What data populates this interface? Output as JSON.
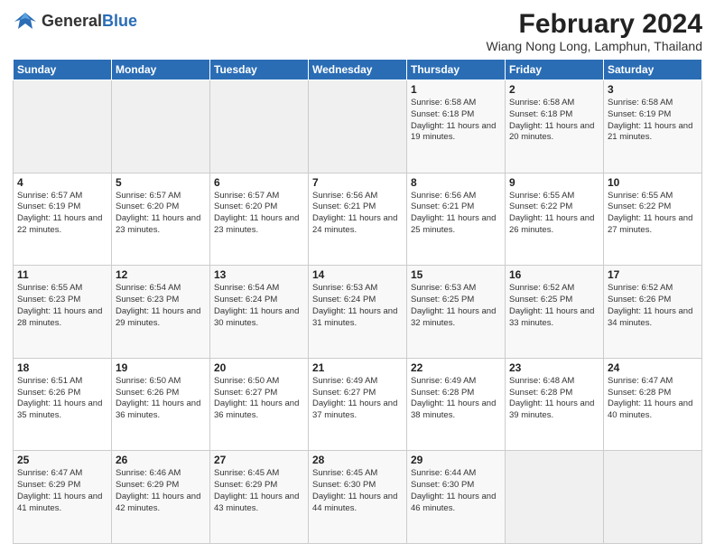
{
  "header": {
    "logo_general": "General",
    "logo_blue": "Blue",
    "title": "February 2024",
    "subtitle": "Wiang Nong Long, Lamphun, Thailand"
  },
  "weekdays": [
    "Sunday",
    "Monday",
    "Tuesday",
    "Wednesday",
    "Thursday",
    "Friday",
    "Saturday"
  ],
  "weeks": [
    [
      {
        "day": "",
        "sunrise": "",
        "sunset": "",
        "daylight": ""
      },
      {
        "day": "",
        "sunrise": "",
        "sunset": "",
        "daylight": ""
      },
      {
        "day": "",
        "sunrise": "",
        "sunset": "",
        "daylight": ""
      },
      {
        "day": "",
        "sunrise": "",
        "sunset": "",
        "daylight": ""
      },
      {
        "day": "1",
        "sunrise": "Sunrise: 6:58 AM",
        "sunset": "Sunset: 6:18 PM",
        "daylight": "Daylight: 11 hours and 19 minutes."
      },
      {
        "day": "2",
        "sunrise": "Sunrise: 6:58 AM",
        "sunset": "Sunset: 6:18 PM",
        "daylight": "Daylight: 11 hours and 20 minutes."
      },
      {
        "day": "3",
        "sunrise": "Sunrise: 6:58 AM",
        "sunset": "Sunset: 6:19 PM",
        "daylight": "Daylight: 11 hours and 21 minutes."
      }
    ],
    [
      {
        "day": "4",
        "sunrise": "Sunrise: 6:57 AM",
        "sunset": "Sunset: 6:19 PM",
        "daylight": "Daylight: 11 hours and 22 minutes."
      },
      {
        "day": "5",
        "sunrise": "Sunrise: 6:57 AM",
        "sunset": "Sunset: 6:20 PM",
        "daylight": "Daylight: 11 hours and 23 minutes."
      },
      {
        "day": "6",
        "sunrise": "Sunrise: 6:57 AM",
        "sunset": "Sunset: 6:20 PM",
        "daylight": "Daylight: 11 hours and 23 minutes."
      },
      {
        "day": "7",
        "sunrise": "Sunrise: 6:56 AM",
        "sunset": "Sunset: 6:21 PM",
        "daylight": "Daylight: 11 hours and 24 minutes."
      },
      {
        "day": "8",
        "sunrise": "Sunrise: 6:56 AM",
        "sunset": "Sunset: 6:21 PM",
        "daylight": "Daylight: 11 hours and 25 minutes."
      },
      {
        "day": "9",
        "sunrise": "Sunrise: 6:55 AM",
        "sunset": "Sunset: 6:22 PM",
        "daylight": "Daylight: 11 hours and 26 minutes."
      },
      {
        "day": "10",
        "sunrise": "Sunrise: 6:55 AM",
        "sunset": "Sunset: 6:22 PM",
        "daylight": "Daylight: 11 hours and 27 minutes."
      }
    ],
    [
      {
        "day": "11",
        "sunrise": "Sunrise: 6:55 AM",
        "sunset": "Sunset: 6:23 PM",
        "daylight": "Daylight: 11 hours and 28 minutes."
      },
      {
        "day": "12",
        "sunrise": "Sunrise: 6:54 AM",
        "sunset": "Sunset: 6:23 PM",
        "daylight": "Daylight: 11 hours and 29 minutes."
      },
      {
        "day": "13",
        "sunrise": "Sunrise: 6:54 AM",
        "sunset": "Sunset: 6:24 PM",
        "daylight": "Daylight: 11 hours and 30 minutes."
      },
      {
        "day": "14",
        "sunrise": "Sunrise: 6:53 AM",
        "sunset": "Sunset: 6:24 PM",
        "daylight": "Daylight: 11 hours and 31 minutes."
      },
      {
        "day": "15",
        "sunrise": "Sunrise: 6:53 AM",
        "sunset": "Sunset: 6:25 PM",
        "daylight": "Daylight: 11 hours and 32 minutes."
      },
      {
        "day": "16",
        "sunrise": "Sunrise: 6:52 AM",
        "sunset": "Sunset: 6:25 PM",
        "daylight": "Daylight: 11 hours and 33 minutes."
      },
      {
        "day": "17",
        "sunrise": "Sunrise: 6:52 AM",
        "sunset": "Sunset: 6:26 PM",
        "daylight": "Daylight: 11 hours and 34 minutes."
      }
    ],
    [
      {
        "day": "18",
        "sunrise": "Sunrise: 6:51 AM",
        "sunset": "Sunset: 6:26 PM",
        "daylight": "Daylight: 11 hours and 35 minutes."
      },
      {
        "day": "19",
        "sunrise": "Sunrise: 6:50 AM",
        "sunset": "Sunset: 6:26 PM",
        "daylight": "Daylight: 11 hours and 36 minutes."
      },
      {
        "day": "20",
        "sunrise": "Sunrise: 6:50 AM",
        "sunset": "Sunset: 6:27 PM",
        "daylight": "Daylight: 11 hours and 36 minutes."
      },
      {
        "day": "21",
        "sunrise": "Sunrise: 6:49 AM",
        "sunset": "Sunset: 6:27 PM",
        "daylight": "Daylight: 11 hours and 37 minutes."
      },
      {
        "day": "22",
        "sunrise": "Sunrise: 6:49 AM",
        "sunset": "Sunset: 6:28 PM",
        "daylight": "Daylight: 11 hours and 38 minutes."
      },
      {
        "day": "23",
        "sunrise": "Sunrise: 6:48 AM",
        "sunset": "Sunset: 6:28 PM",
        "daylight": "Daylight: 11 hours and 39 minutes."
      },
      {
        "day": "24",
        "sunrise": "Sunrise: 6:47 AM",
        "sunset": "Sunset: 6:28 PM",
        "daylight": "Daylight: 11 hours and 40 minutes."
      }
    ],
    [
      {
        "day": "25",
        "sunrise": "Sunrise: 6:47 AM",
        "sunset": "Sunset: 6:29 PM",
        "daylight": "Daylight: 11 hours and 41 minutes."
      },
      {
        "day": "26",
        "sunrise": "Sunrise: 6:46 AM",
        "sunset": "Sunset: 6:29 PM",
        "daylight": "Daylight: 11 hours and 42 minutes."
      },
      {
        "day": "27",
        "sunrise": "Sunrise: 6:45 AM",
        "sunset": "Sunset: 6:29 PM",
        "daylight": "Daylight: 11 hours and 43 minutes."
      },
      {
        "day": "28",
        "sunrise": "Sunrise: 6:45 AM",
        "sunset": "Sunset: 6:30 PM",
        "daylight": "Daylight: 11 hours and 44 minutes."
      },
      {
        "day": "29",
        "sunrise": "Sunrise: 6:44 AM",
        "sunset": "Sunset: 6:30 PM",
        "daylight": "Daylight: 11 hours and 46 minutes."
      },
      {
        "day": "",
        "sunrise": "",
        "sunset": "",
        "daylight": ""
      },
      {
        "day": "",
        "sunrise": "",
        "sunset": "",
        "daylight": ""
      }
    ]
  ]
}
